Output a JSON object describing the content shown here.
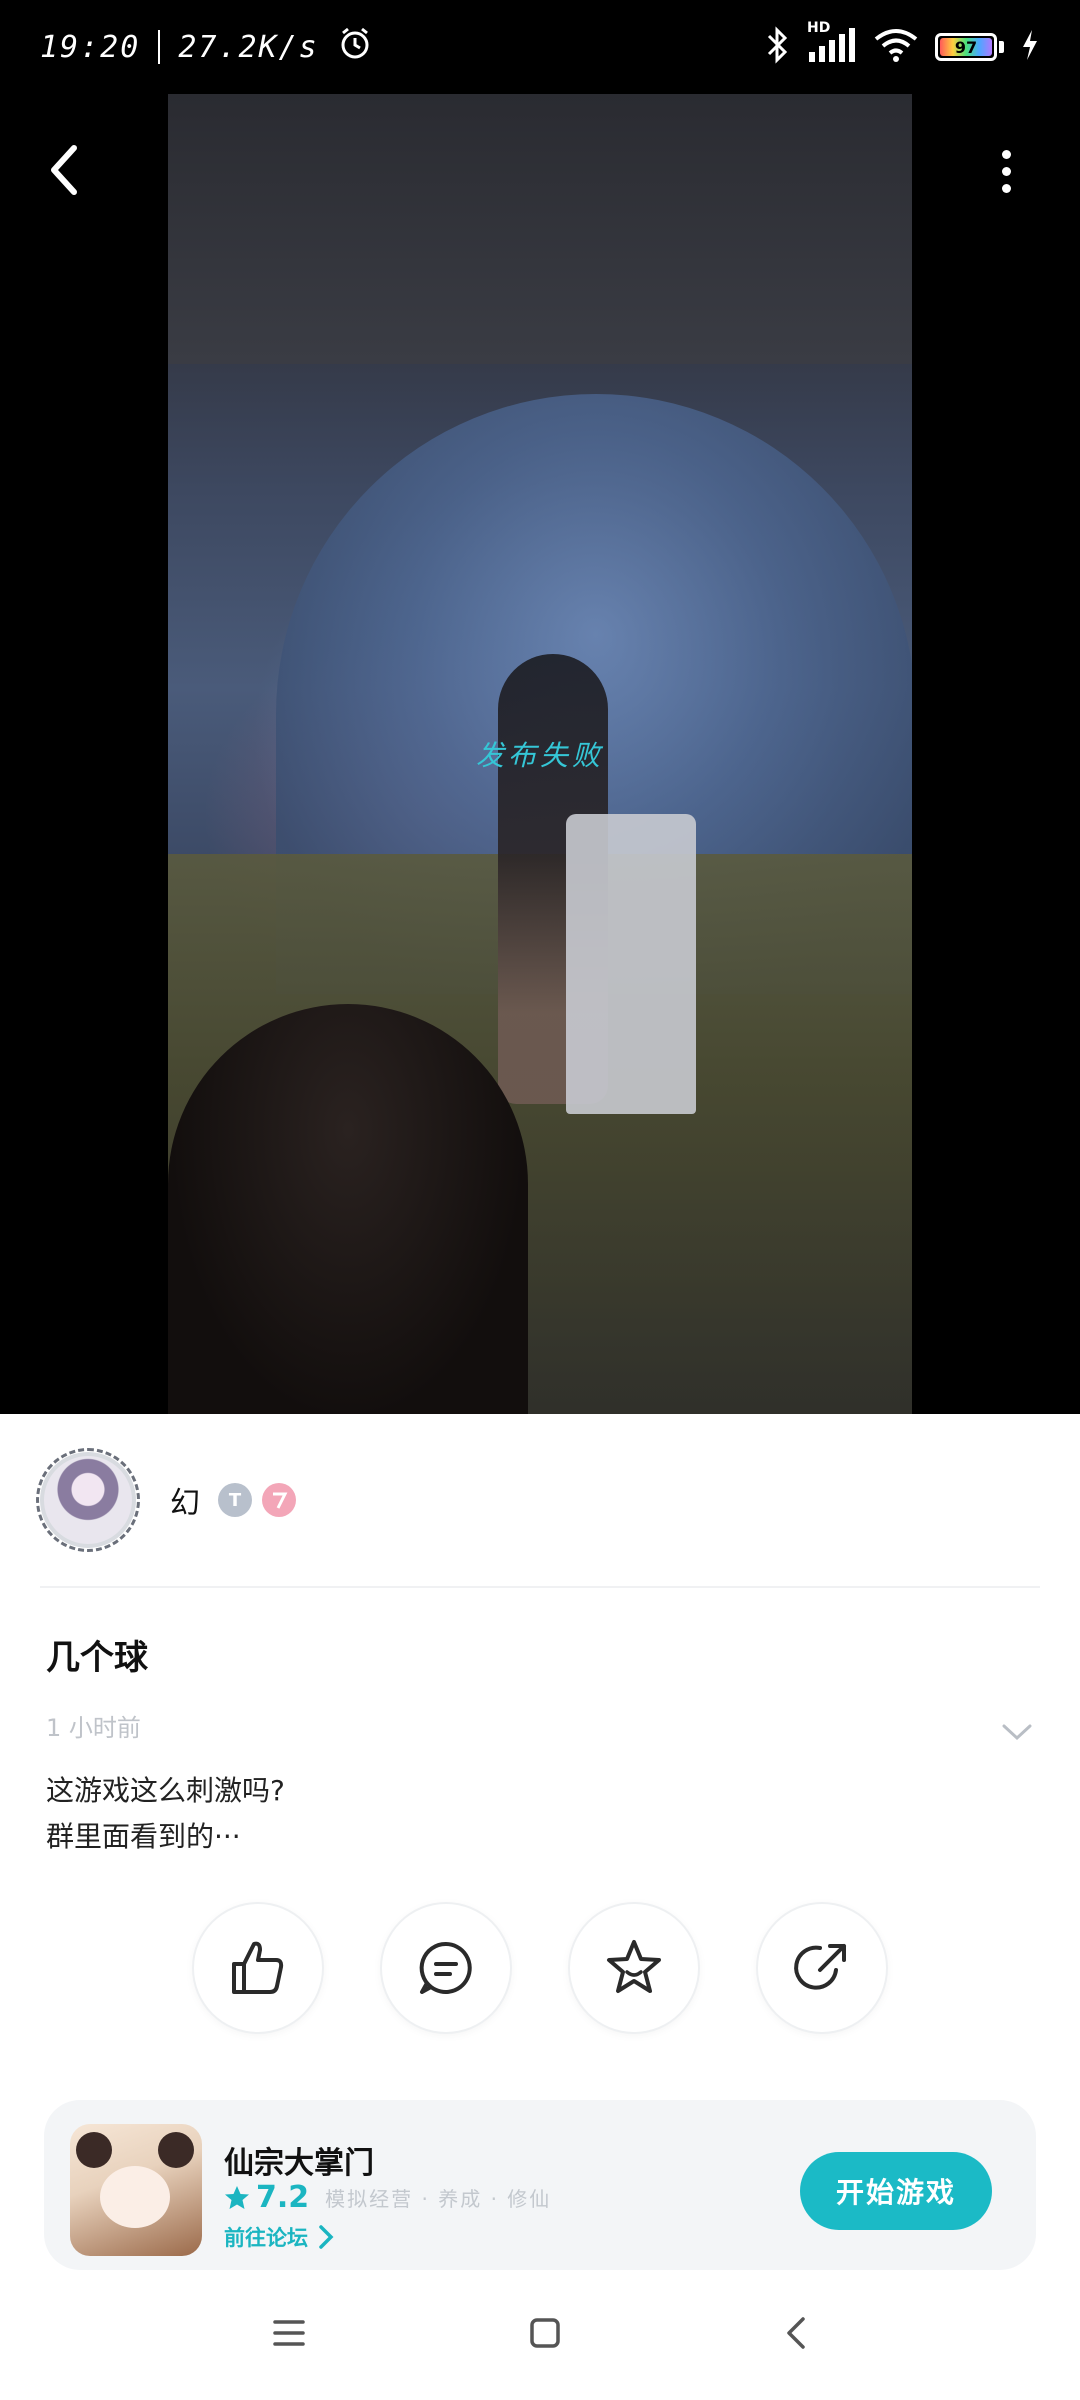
{
  "status_bar": {
    "time": "19:20",
    "net_speed": "27.2K/s",
    "battery_level": "97",
    "network_label": "HD",
    "icons": [
      "alarm-icon",
      "bluetooth-icon",
      "signal-icon",
      "wifi-icon",
      "battery-icon",
      "charging-icon"
    ]
  },
  "video": {
    "overlay_text": "发布失败"
  },
  "header": {
    "icons": [
      "back-arrow-icon",
      "more-vertical-icon"
    ]
  },
  "author": {
    "name": "幻",
    "badge_t_text": "T"
  },
  "post": {
    "title": "几个球",
    "time": "1 小时前",
    "body_line1": "这游戏这么刺激吗?",
    "body_line2": "群里面看到的···"
  },
  "actions": {
    "icons": [
      "like-icon",
      "comment-icon",
      "favorite-icon",
      "share-icon"
    ]
  },
  "game": {
    "name": "仙宗大掌门",
    "score": "7.2",
    "tags": "模拟经营 · 养成 · 修仙",
    "forum_label": "前往论坛",
    "start_label": "开始游戏"
  },
  "nav": {
    "icons": [
      "menu-icon",
      "home-icon",
      "back-icon"
    ]
  },
  "colors": {
    "accent": "#1bbac6",
    "overlay_text": "#35c6d6"
  }
}
